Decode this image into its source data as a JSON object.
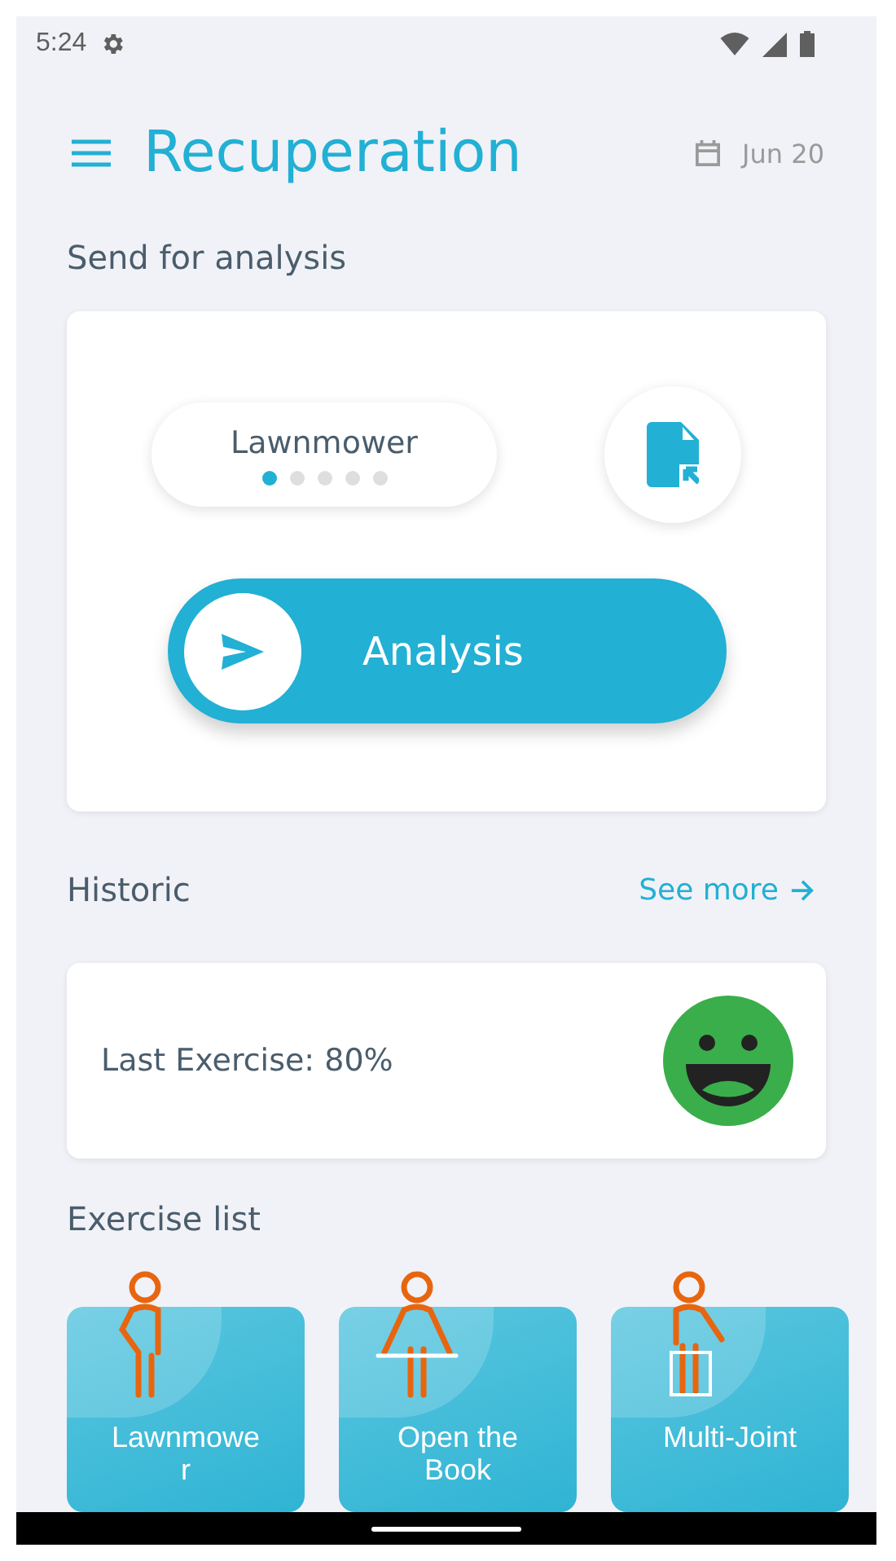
{
  "status_bar": {
    "time": "5:24"
  },
  "header": {
    "title": "Recuperation",
    "date": "Jun 20"
  },
  "send_section": {
    "heading": "Send for analysis",
    "exercise": "Lawnmower",
    "pager_dots": [
      {
        "selected": true
      },
      {
        "selected": false
      },
      {
        "selected": false
      },
      {
        "selected": false
      },
      {
        "selected": false
      }
    ],
    "button": "Analysis"
  },
  "historic": {
    "heading": "Historic",
    "link": "See more",
    "last_exercise": "Last Exercise: 80%"
  },
  "exercise_list": {
    "heading": "Exercise list",
    "items": [
      {
        "label": "Lawnmower"
      },
      {
        "label": "Open the Book"
      },
      {
        "label": "Multi-Joint"
      }
    ]
  }
}
